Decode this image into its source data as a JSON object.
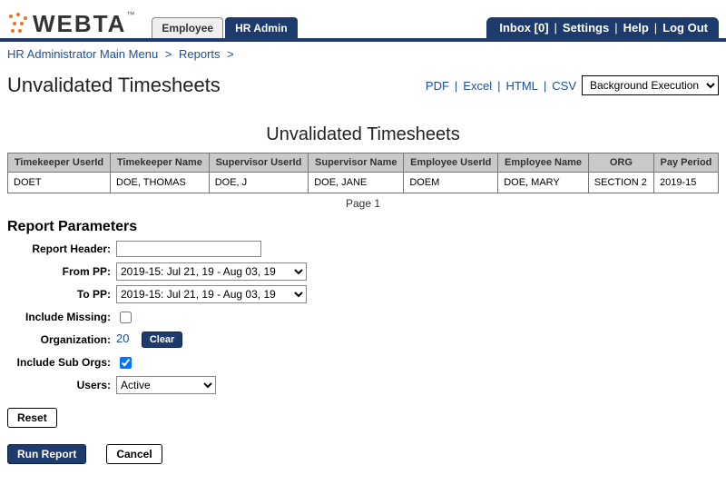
{
  "app": {
    "name": "WEBTA"
  },
  "tabs": {
    "employee": "Employee",
    "hradmin": "HR Admin"
  },
  "util": {
    "inbox": "Inbox [0]",
    "settings": "Settings",
    "help": "Help",
    "logout": "Log Out"
  },
  "breadcrumb": {
    "root": "HR Administrator Main Menu",
    "level1": "Reports"
  },
  "page_title": "Unvalidated Timesheets",
  "export": {
    "pdf": "PDF",
    "excel": "Excel",
    "html": "HTML",
    "csv": "CSV",
    "bgexec": "Background Execution"
  },
  "section_title": "Unvalidated Timesheets",
  "table": {
    "headers": {
      "tk_userid": "Timekeeper UserId",
      "tk_name": "Timekeeper Name",
      "sup_userid": "Supervisor UserId",
      "sup_name": "Supervisor Name",
      "emp_userid": "Employee UserId",
      "emp_name": "Employee Name",
      "org": "ORG",
      "pp": "Pay Period"
    },
    "rows": [
      {
        "tk_userid": "DOET",
        "tk_name": "DOE, THOMAS",
        "sup_userid": "DOE, J",
        "sup_name": "DOE, JANE",
        "emp_userid": "DOEM",
        "emp_name": "DOE, MARY",
        "org": "SECTION 2",
        "pp": "2019-15"
      }
    ],
    "pager": "Page 1"
  },
  "params_head": "Report Parameters",
  "params": {
    "labels": {
      "report_header": "Report Header:",
      "from_pp": "From PP:",
      "to_pp": "To PP:",
      "include_missing": "Include Missing:",
      "organization": "Organization:",
      "include_suborgs": "Include Sub Orgs:",
      "users": "Users:"
    },
    "values": {
      "report_header": "",
      "from_pp": "2019-15: Jul 21, 19 - Aug 03, 19",
      "to_pp": "2019-15: Jul 21, 19 - Aug 03, 19",
      "include_missing": false,
      "organization": "20",
      "include_suborgs": true,
      "users": "Active"
    },
    "clear_btn": "Clear"
  },
  "buttons": {
    "reset": "Reset",
    "run": "Run Report",
    "cancel": "Cancel"
  }
}
